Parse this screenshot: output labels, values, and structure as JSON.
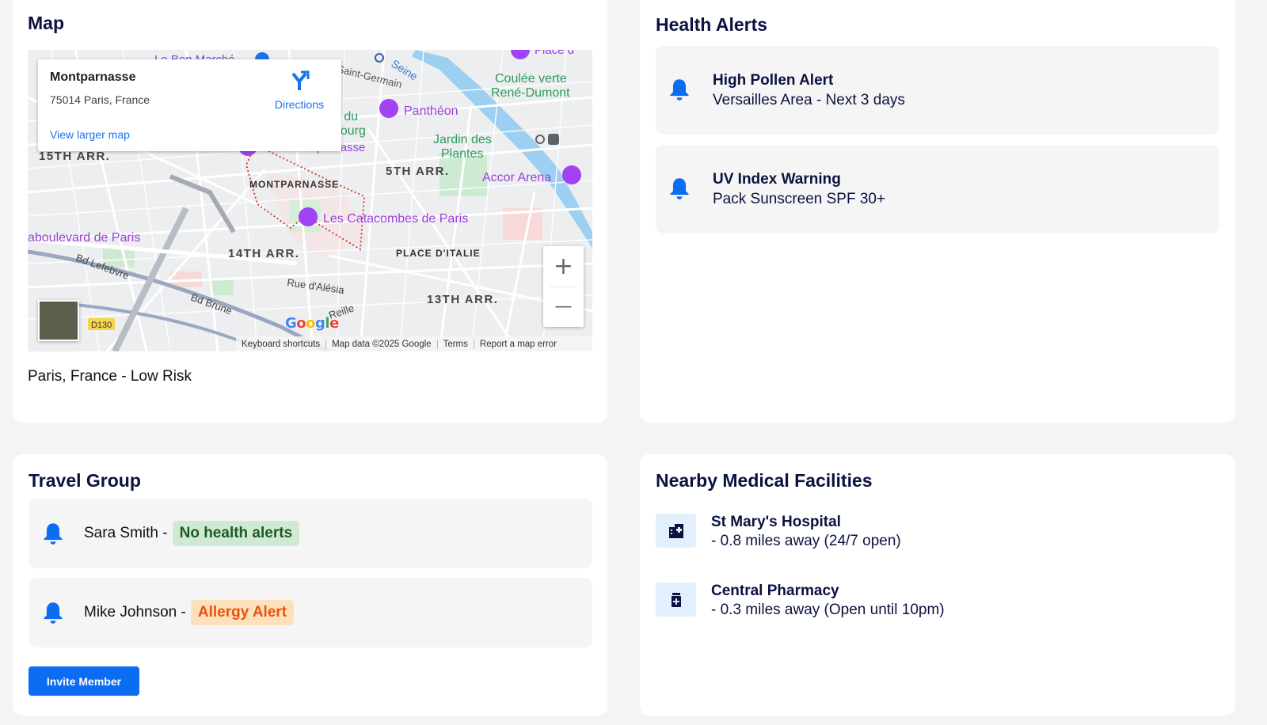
{
  "map_card": {
    "title": "Map",
    "infobox": {
      "place": "Montparnasse",
      "address": "75014 Paris, France",
      "larger_map": "View larger map",
      "directions": "Directions"
    },
    "labels": {
      "bon_marche": "Le Bon Marché",
      "saint_germain": "Saint-Germain",
      "seine": "Seine",
      "place": "Place d",
      "coulee": "Coulée verte",
      "rene": "René-Dumont",
      "pantheon": "Panthéon",
      "jardin1": "Jardin des",
      "jardin2": "Plantes",
      "du": "n du",
      "bourg": "bourg",
      "tour": "Tour Montparnasse",
      "arr15": "15TH ARR.",
      "arr5": "5TH ARR.",
      "accor": "Accor Arena",
      "montparnasse": "MONTPARNASSE",
      "catacombes": "Les Catacombes de Paris",
      "boulevard": "aboulevard de Paris",
      "arr14": "14TH ARR.",
      "place_italie": "PLACE D'ITALIE",
      "lefebvre": "Bd Lefebvre",
      "alesia": "Rue d'Alésia",
      "brune": "Bd Brune",
      "reille": "Reille",
      "arr13": "13TH ARR.",
      "d130": "D130"
    },
    "google": "Google",
    "footer": [
      "Keyboard shortcuts",
      "Map data ©2025 Google",
      "Terms",
      "Report a map error"
    ],
    "zoom_in": "+",
    "zoom_out": "—",
    "caption": "Paris, France - Low Risk"
  },
  "alerts_card": {
    "title": "Health Alerts",
    "alerts": [
      {
        "title": "High Pollen Alert",
        "detail": "Versailles Area - Next 3 days"
      },
      {
        "title": "UV Index Warning",
        "detail": "Pack Sunscreen SPF 30+"
      }
    ]
  },
  "group_card": {
    "title": "Travel Group",
    "members": [
      {
        "name": "Sara Smith -",
        "status": "No health alerts"
      },
      {
        "name": "Mike Johnson -",
        "status": "Allergy Alert"
      }
    ],
    "invite_label": "Invite Member"
  },
  "facilities_card": {
    "title": "Nearby Medical Facilities",
    "facilities": [
      {
        "name": "St Mary's Hospital",
        "info": "- 0.8 miles away (24/7 open)",
        "icon": "hospital-icon"
      },
      {
        "name": "Central Pharmacy",
        "info": "- 0.3 miles away (Open until 10pm)",
        "icon": "pharmacy-icon"
      }
    ]
  },
  "colors": {
    "primary": "#0c6cf2",
    "heading": "#0b1240",
    "ok_badge_bg": "#cfe9d3",
    "ok_badge_text": "#1c5b24",
    "warn_badge_bg": "#fde0bc",
    "warn_badge_text": "#e8540e"
  }
}
